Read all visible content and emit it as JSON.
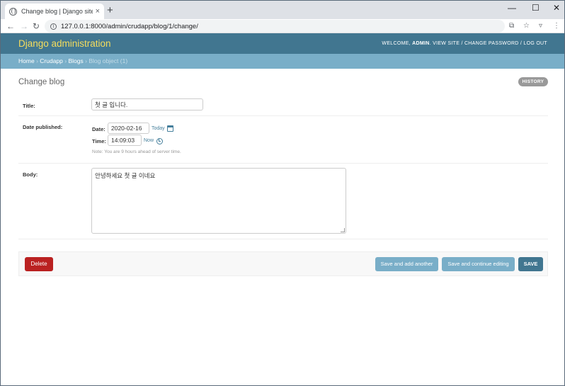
{
  "browser": {
    "tab_title": "Change blog | Django site adm",
    "tab_close": "×",
    "new_tab": "+",
    "url": "127.0.0.1:8000/admin/crudapp/blog/1/change/",
    "window_controls": [
      "—",
      "☐",
      "✕"
    ]
  },
  "header": {
    "brand": "Django administration",
    "welcome": "WELCOME,",
    "user": "ADMIN",
    "tools_rest": ". VIEW SITE / CHANGE PASSWORD / LOG OUT"
  },
  "breadcrumbs": {
    "home": "Home",
    "app": "Crudapp",
    "model": "Blogs",
    "current": "Blog object (1)",
    "sep": "›"
  },
  "page": {
    "title": "Change blog",
    "history": "HISTORY"
  },
  "form": {
    "title_label": "Title:",
    "title_value": "첫 글 입니다.",
    "date_published_label": "Date published:",
    "date_label": "Date:",
    "date_value": "2020-02-16",
    "today_link": "Today",
    "time_label": "Time:",
    "time_value": "14:09:03",
    "now_link": "Now",
    "timezone_note": "Note: You are 9 hours ahead of server time.",
    "body_label": "Body:",
    "body_value": "안녕하세요 첫 글 이네요"
  },
  "actions": {
    "delete": "Delete",
    "save_add_another": "Save and add another",
    "save_continue": "Save and continue editing",
    "save": "SAVE"
  },
  "colors": {
    "header": "#417690",
    "brand": "#f5dd5d",
    "breadcrumbs": "#79aec8",
    "delete": "#ba2121"
  }
}
